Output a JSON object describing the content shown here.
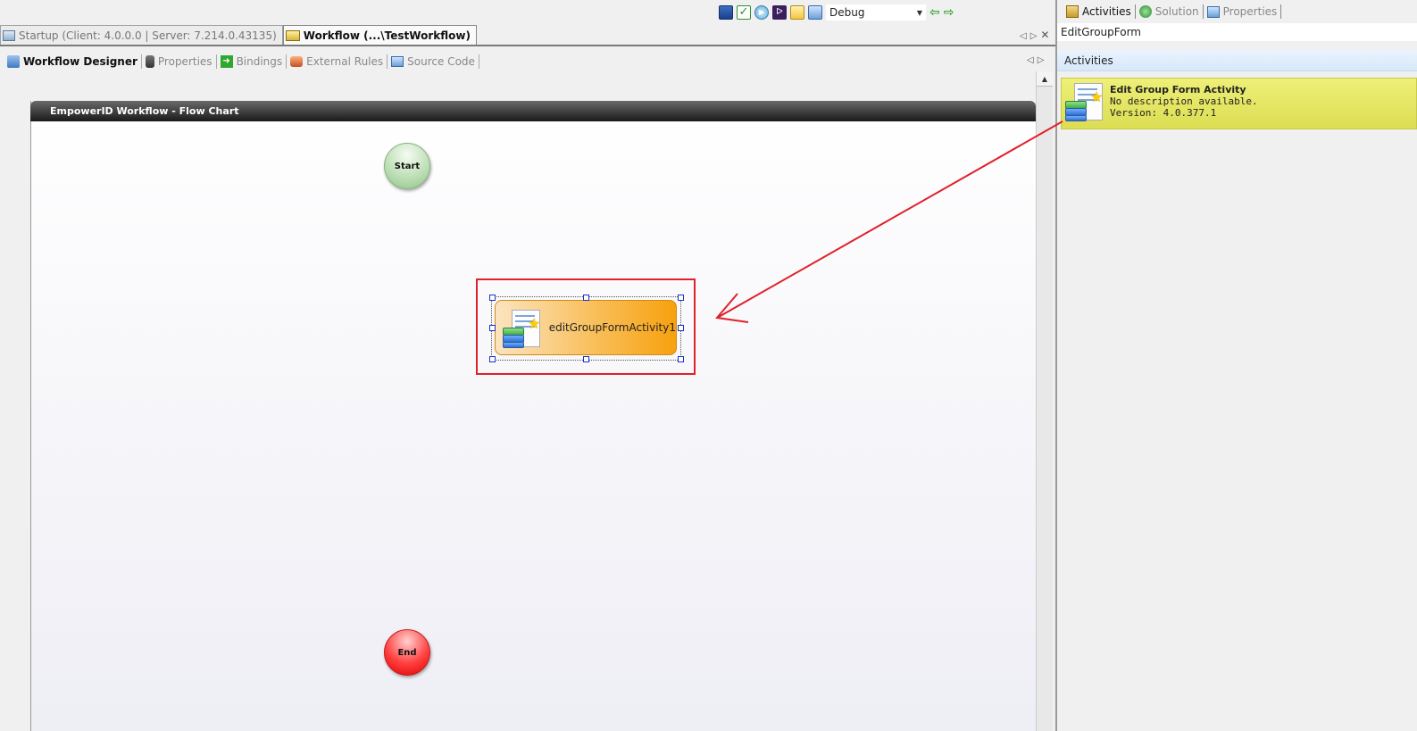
{
  "toolbar": {
    "icons": [
      "save-icon",
      "check-icon",
      "run-icon",
      "visual-studio-icon",
      "note-icon",
      "deploy-icon"
    ],
    "config_value": "Debug",
    "nav_icons": [
      "back-arrow-icon",
      "forward-arrow-icon"
    ]
  },
  "doc_tabs": [
    {
      "label": "Startup (Client: 4.0.0.0 | Server: 7.214.0.43135)",
      "active": false
    },
    {
      "label": "Workflow (...\\TestWorkflow)",
      "active": true
    }
  ],
  "sub_tabs": [
    {
      "label": "Workflow Designer",
      "active": true
    },
    {
      "label": "Properties",
      "active": false
    },
    {
      "label": "Bindings",
      "active": false
    },
    {
      "label": "External Rules",
      "active": false
    },
    {
      "label": "Source Code",
      "active": false
    }
  ],
  "designer": {
    "title": "EmpowerID Workflow - Flow Chart",
    "start_label": "Start",
    "end_label": "End",
    "activity_label": "editGroupFormActivity1"
  },
  "panel": {
    "tabs": [
      {
        "label": "Activities",
        "active": true
      },
      {
        "label": "Solution",
        "active": false
      },
      {
        "label": "Properties",
        "active": false
      }
    ],
    "search_value": "EditGroupForm",
    "section_header": "Activities",
    "item": {
      "name": "Edit Group Form Activity",
      "description": "No description available.",
      "version": "Version:  4.0.377.1"
    }
  },
  "colors": {
    "highlight": "#e0202a",
    "activity_item_bg": "#e4e566",
    "start_node": "#a9d3a1",
    "end_node": "#ff2a2a"
  }
}
